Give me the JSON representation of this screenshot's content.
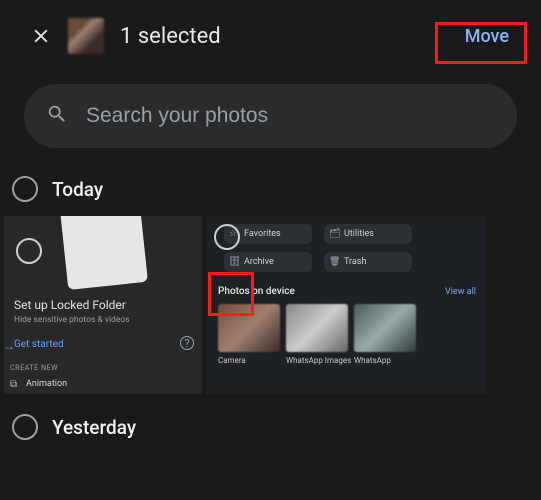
{
  "header": {
    "selected_text": "1 selected",
    "move_label": "Move"
  },
  "search": {
    "placeholder": "Search your photos"
  },
  "sections": {
    "today": "Today",
    "yesterday": "Yesterday"
  },
  "locked_folder_card": {
    "title": "Set up Locked Folder",
    "subtitle": "Hide sensitive photos & videos",
    "cta": "Get started",
    "create_new_label": "CREATE NEW",
    "animation_label": "Animation"
  },
  "library_card": {
    "chips": {
      "favorites": "Favorites",
      "utilities": "Utilities",
      "archive": "Archive",
      "trash": "Trash"
    },
    "photos_on_device_label": "Photos on device",
    "view_all_label": "View all",
    "device_folders": [
      "Camera",
      "WhatsApp Images",
      "WhatsApp"
    ]
  }
}
